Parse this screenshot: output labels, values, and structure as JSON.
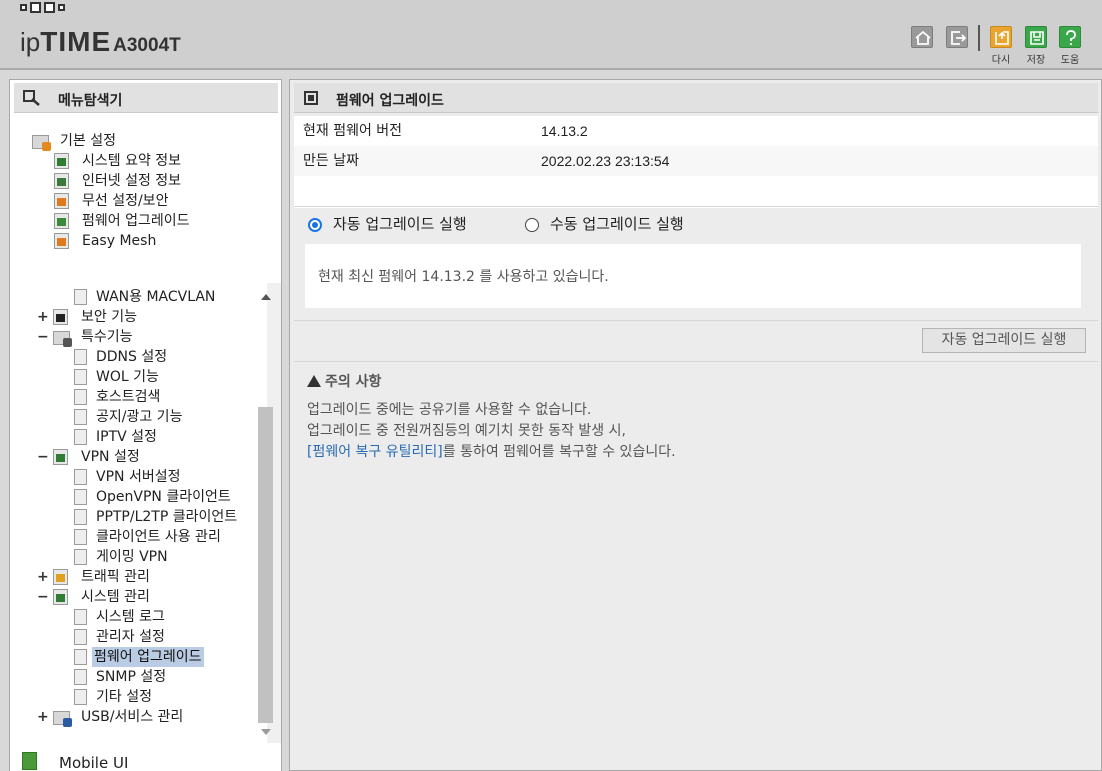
{
  "header": {
    "logo_main": "ipTIME",
    "logo_ip": "ip",
    "logo_time": "TIME",
    "model": "A3004T",
    "buttons": [
      {
        "name": "home",
        "label": ""
      },
      {
        "name": "logout",
        "label": ""
      },
      {
        "name": "retry",
        "label": "다시"
      },
      {
        "name": "save",
        "label": "저장"
      },
      {
        "name": "help",
        "label": "도움"
      }
    ]
  },
  "sidebar": {
    "title": "메뉴탐색기",
    "basic": {
      "label": "기본 설정",
      "items": [
        "시스템 요약 정보",
        "인터넷 설정 정보",
        "무선 설정/보안",
        "펌웨어 업그레이드",
        "Easy Mesh"
      ]
    },
    "advanced": [
      {
        "type": "page",
        "label": "WAN용 MACVLAN"
      },
      {
        "type": "group",
        "expander": "+",
        "label": "보안 기능"
      },
      {
        "type": "group",
        "expander": "−",
        "label": "특수기능"
      },
      {
        "type": "page",
        "label": "DDNS 설정"
      },
      {
        "type": "page",
        "label": "WOL 기능"
      },
      {
        "type": "page",
        "label": "호스트검색"
      },
      {
        "type": "page",
        "label": "공지/광고 기능"
      },
      {
        "type": "page",
        "label": "IPTV 설정"
      },
      {
        "type": "group",
        "expander": "−",
        "label": "VPN 설정"
      },
      {
        "type": "page",
        "label": "VPN 서버설정"
      },
      {
        "type": "page",
        "label": "OpenVPN 클라이언트"
      },
      {
        "type": "page",
        "label": "PPTP/L2TP 클라이언트"
      },
      {
        "type": "page",
        "label": "클라이언트 사용 관리"
      },
      {
        "type": "page",
        "label": "게이밍 VPN"
      },
      {
        "type": "group",
        "expander": "+",
        "label": "트래픽 관리"
      },
      {
        "type": "group",
        "expander": "−",
        "label": "시스템 관리"
      },
      {
        "type": "page",
        "label": "시스템 로그"
      },
      {
        "type": "page",
        "label": "관리자 설정"
      },
      {
        "type": "page",
        "label": "펌웨어 업그레이드",
        "selected": true
      },
      {
        "type": "page",
        "label": "SNMP 설정"
      },
      {
        "type": "page",
        "label": "기타 설정"
      },
      {
        "type": "group",
        "expander": "+",
        "label": "USB/서비스 관리"
      }
    ],
    "mobile_ui": "Mobile UI"
  },
  "main": {
    "title": "펌웨어 업그레이드",
    "info": [
      {
        "label": "현재 펌웨어 버전",
        "value": "14.13.2"
      },
      {
        "label": "만든 날짜",
        "value": "2022.02.23 23:13:54"
      }
    ],
    "mode": {
      "auto_label": "자동 업그레이드 실행",
      "manual_label": "수동 업그레이드 실행",
      "selected": "auto"
    },
    "status_message": "현재 최신 펌웨어 14.13.2 를 사용하고 있습니다.",
    "auto_button": "자동 업그레이드 실행",
    "notice": {
      "title": "주의 사항",
      "line1": "업그레이드 중에는 공유기를 사용할 수 없습니다.",
      "line2": "업그레이드 중 전원꺼짐등의 예기치 못한 동작 발생 시,",
      "line3_link": "[펌웨어 복구 유틸리티]",
      "line3_rest": "를 통하여 펌웨어를 복구할 수 있습니다."
    }
  },
  "colors": {
    "accent": "#1a73e8",
    "selection": "#bacbe4",
    "link": "#2a6ab0",
    "help_green": "#3aa74a",
    "retry_orange": "#e8a630"
  }
}
